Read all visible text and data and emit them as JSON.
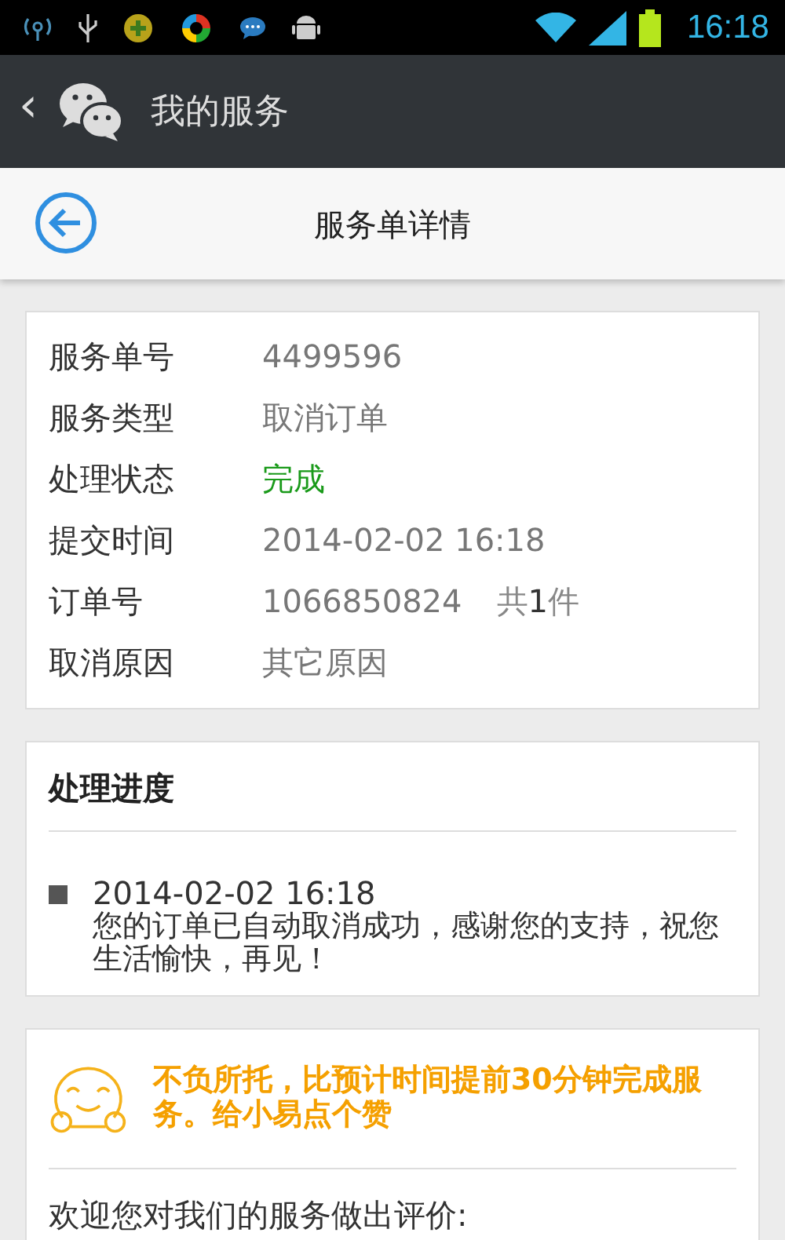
{
  "status_bar": {
    "time": "16:18"
  },
  "app_bar": {
    "back": "‹",
    "title": "我的服务"
  },
  "header": {
    "title": "服务单详情"
  },
  "details": [
    {
      "label": "服务单号",
      "value": "4499596",
      "kind": "text"
    },
    {
      "label": "服务类型",
      "value": "取消订单",
      "kind": "text"
    },
    {
      "label": "处理状态",
      "value": "完成",
      "kind": "status"
    },
    {
      "label": "提交时间",
      "value": "2014-02-02 16:18",
      "kind": "text"
    },
    {
      "label": "订单号",
      "value": "1066850824",
      "extra": "共**1**件",
      "kind": "text"
    },
    {
      "label": "取消原因",
      "value": "其它原因",
      "kind": "text"
    }
  ],
  "progress": {
    "title": "处理进度",
    "entries": [
      {
        "time": "2014-02-02 16:18",
        "text": "您的订单已自动取消成功，感谢您的支持，祝您生活愉快，再见！"
      }
    ]
  },
  "rating": {
    "message": "不负所托，比预计时间提前30分钟完成服务。给小易点个赞",
    "prompt": "欢迎您对我们的服务做出评价:"
  }
}
